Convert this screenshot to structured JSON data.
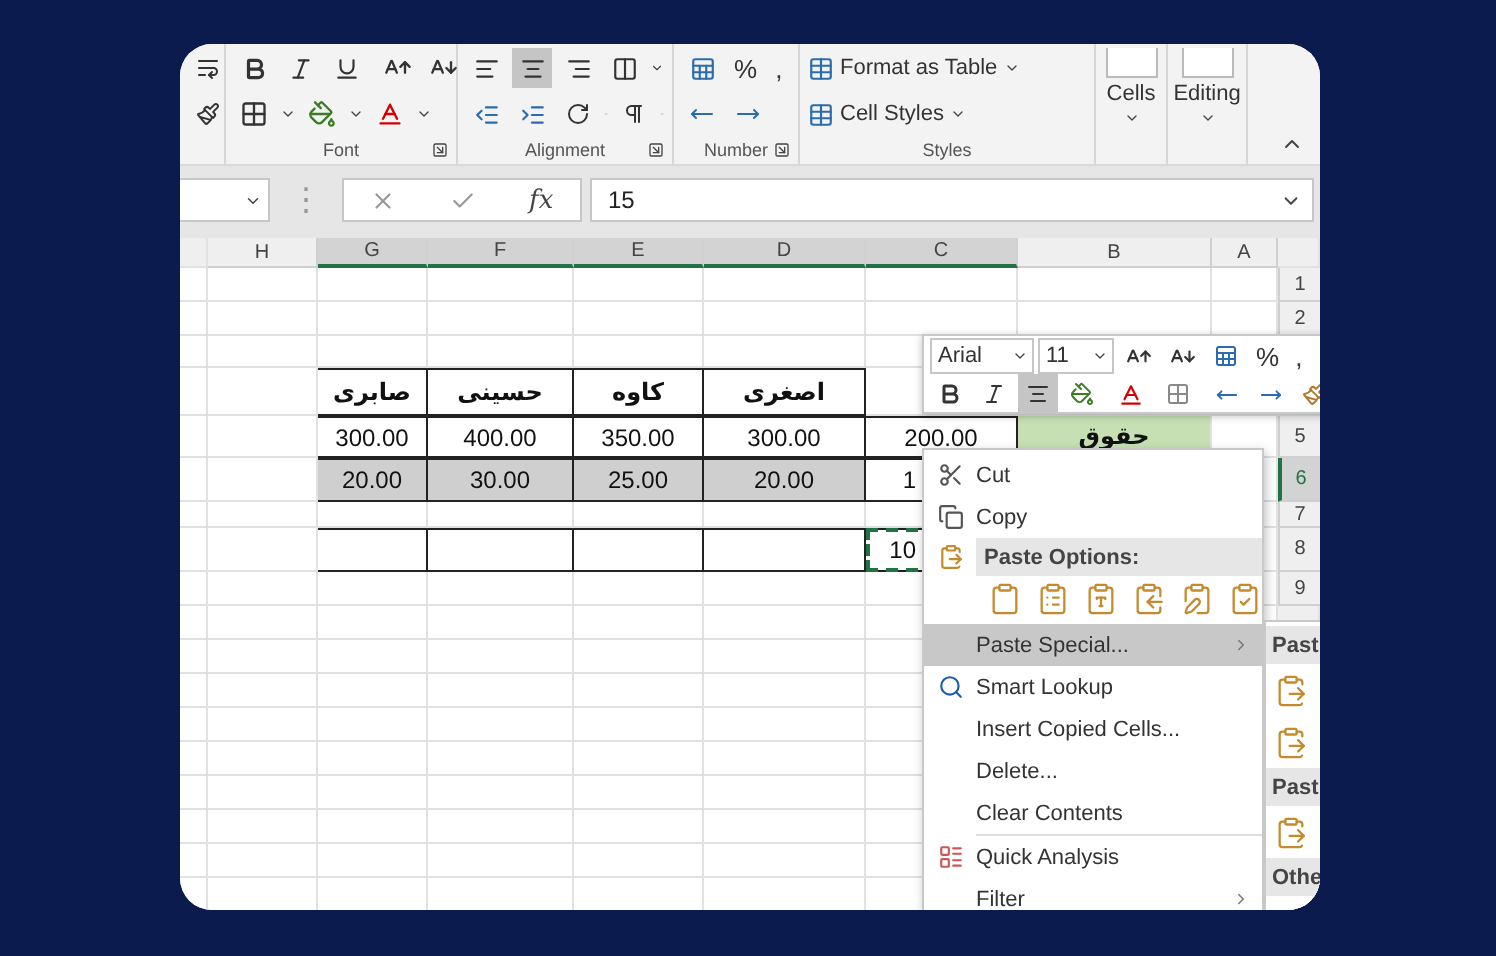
{
  "ribbon": {
    "alignment_buttons": [
      {
        "kind": "left",
        "selected": false
      },
      {
        "kind": "center",
        "selected": true
      },
      {
        "kind": "right",
        "selected": false
      }
    ],
    "groups": [
      "Font",
      "Alignment",
      "Number",
      "Styles"
    ],
    "number_symbols": [
      "%",
      ","
    ],
    "styles_buttons": [
      "Format as Table",
      "Cell Styles"
    ],
    "cells_button": "Cells",
    "editing_button": "Editing"
  },
  "formula_bar": {
    "separator": "⋮",
    "function_label": "fx",
    "value": "15"
  },
  "sheet": {
    "columns": [
      {
        "label": "H",
        "selected": false
      },
      {
        "label": "G",
        "selected": true
      },
      {
        "label": "F",
        "selected": true
      },
      {
        "label": "E",
        "selected": true
      },
      {
        "label": "D",
        "selected": true
      },
      {
        "label": "C",
        "selected": true
      },
      {
        "label": "B",
        "selected": false
      },
      {
        "label": "A",
        "selected": false
      }
    ],
    "rows": [
      {
        "number": "1",
        "selected": false,
        "kind": "blank",
        "cells": [
          null,
          null,
          null,
          null,
          null,
          null,
          null,
          null
        ]
      },
      {
        "number": "2",
        "selected": false,
        "kind": "blank",
        "cells": [
          null,
          null,
          null,
          null,
          null,
          null,
          null,
          null
        ]
      },
      {
        "kind": "blank",
        "cells": [
          null,
          null,
          null,
          null,
          null,
          null,
          null,
          null
        ]
      },
      {
        "kind": "header",
        "cells": [
          null,
          {
            "text": "صابری"
          },
          {
            "text": "حسینی"
          },
          {
            "text": "کاوه"
          },
          {
            "text": "اصغری"
          },
          null,
          null,
          null
        ]
      },
      {
        "number": "5",
        "selected": false,
        "kind": "data",
        "cells": [
          null,
          {
            "text": "300.00"
          },
          {
            "text": "400.00"
          },
          {
            "text": "350.00"
          },
          {
            "text": "300.00"
          },
          {
            "text": "200.00"
          },
          {
            "text": "حقوق",
            "highlighted": true
          },
          null
        ]
      },
      {
        "number": "6",
        "selected": true,
        "kind": "data",
        "cells": [
          null,
          {
            "text": "20.00",
            "selected": true
          },
          {
            "text": "30.00",
            "selected": true
          },
          {
            "text": "25.00",
            "selected": true
          },
          {
            "text": "20.00",
            "selected": true
          },
          {
            "text": "1"
          },
          null,
          null
        ]
      },
      {
        "number": "7",
        "selected": false,
        "kind": "blank",
        "cells": [
          null,
          null,
          null,
          null,
          null,
          null,
          null,
          null
        ]
      },
      {
        "number": "8",
        "selected": false,
        "kind": "data",
        "cells": [
          null,
          {},
          {},
          {},
          {},
          {
            "text": "10",
            "copied": true
          },
          null,
          null
        ]
      },
      {
        "number": "9",
        "selected": false,
        "kind": "blank",
        "cells": [
          null,
          null,
          null,
          null,
          null,
          null,
          null,
          null
        ]
      }
    ]
  },
  "mini_toolbar": {
    "font": "Arial",
    "size": "11",
    "symbols": [
      "%",
      ","
    ],
    "center_selected": true
  },
  "context_menu": {
    "items": [
      {
        "kind": "command",
        "label": "Cut",
        "selected": false,
        "submenu": false
      },
      {
        "kind": "command",
        "label": "Copy",
        "selected": false,
        "submenu": false
      },
      {
        "kind": "heading",
        "label": "Paste Options:"
      },
      {
        "kind": "paste-icons"
      },
      {
        "kind": "command",
        "label": "Paste Special...",
        "selected": true,
        "submenu": true
      },
      {
        "kind": "command",
        "label": "Smart Lookup",
        "selected": false,
        "submenu": false
      },
      {
        "kind": "command",
        "label": "Insert Copied Cells...",
        "selected": false,
        "submenu": false
      },
      {
        "kind": "command",
        "label": "Delete...",
        "selected": false,
        "submenu": false
      },
      {
        "kind": "command",
        "label": "Clear Contents",
        "selected": false,
        "submenu": false
      },
      {
        "kind": "command",
        "label": "Quick Analysis",
        "selected": false,
        "submenu": false
      },
      {
        "kind": "command",
        "label": "Filter",
        "selected": false,
        "submenu": true
      }
    ]
  },
  "submenu": {
    "items": [
      {
        "kind": "heading",
        "label": "Past"
      },
      {
        "kind": "icon"
      },
      {
        "kind": "icon"
      },
      {
        "kind": "heading",
        "label": "Past"
      },
      {
        "kind": "icon"
      },
      {
        "kind": "heading",
        "label": "Othe"
      }
    ]
  }
}
